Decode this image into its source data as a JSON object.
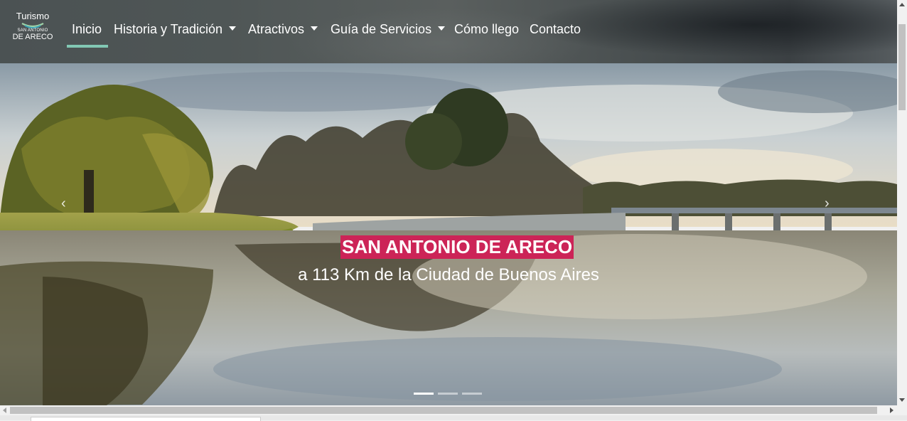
{
  "brand": {
    "top": "Turismo",
    "small": "SAN ANTONIO",
    "big": "DE ARECO"
  },
  "nav": {
    "items": [
      {
        "label": "Inicio",
        "dropdown": false,
        "active": true
      },
      {
        "label": "Historia y Tradición",
        "dropdown": true,
        "active": false
      },
      {
        "label": "Atractivos",
        "dropdown": true,
        "active": false
      },
      {
        "label": "Guía de Servicios",
        "dropdown": true,
        "active": false
      },
      {
        "label": "Cómo llego",
        "dropdown": false,
        "active": false
      },
      {
        "label": "Contacto",
        "dropdown": false,
        "active": false
      }
    ],
    "active_color": "#82c8b4"
  },
  "hero": {
    "title": "SAN ANTONIO DE ARECO",
    "subtitle": "a 113 Km de la Ciudad de Buenos Aires",
    "title_bg": "#cc2457",
    "prev_glyph": "‹",
    "next_glyph": "›",
    "slides_count": 3,
    "active_slide": 1
  },
  "icons": {
    "prev": "chevron-left-icon",
    "next": "chevron-right-icon",
    "caret": "caret-down-icon"
  }
}
